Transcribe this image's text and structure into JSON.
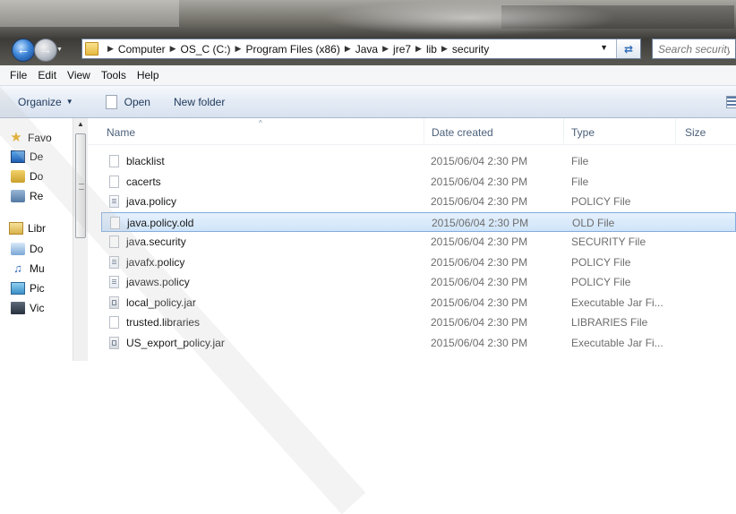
{
  "search": {
    "placeholder": "Search security"
  },
  "breadcrumb": [
    "Computer",
    "OS_C (C:)",
    "Program Files (x86)",
    "Java",
    "jre7",
    "lib",
    "security"
  ],
  "menu": [
    "File",
    "Edit",
    "View",
    "Tools",
    "Help"
  ],
  "toolbar": {
    "organize": "Organize",
    "open": "Open",
    "new_folder": "New folder"
  },
  "nav_items": [
    {
      "label": "Favo",
      "icon": "star-icon"
    },
    {
      "label": "De",
      "icon": "desktop-icon"
    },
    {
      "label": "Do",
      "icon": "downloads-icon"
    },
    {
      "label": "Re",
      "icon": "recent-places-icon"
    },
    {
      "label": "Libr",
      "icon": "libraries-icon"
    },
    {
      "label": "Do",
      "icon": "documents-icon"
    },
    {
      "label": "Mu",
      "icon": "music-icon"
    },
    {
      "label": "Pic",
      "icon": "pictures-icon"
    },
    {
      "label": "Vic",
      "icon": "videos-icon"
    }
  ],
  "columns": {
    "name": "Name",
    "date": "Date created",
    "type": "Type",
    "size": "Size"
  },
  "files": [
    {
      "name": "blacklist",
      "date": "2015/06/04 2:30 PM",
      "type": "File",
      "icon": "file-icon"
    },
    {
      "name": "cacerts",
      "date": "2015/06/04 2:30 PM",
      "type": "File",
      "icon": "file-icon"
    },
    {
      "name": "java.policy",
      "date": "2015/06/04 2:30 PM",
      "type": "POLICY File",
      "icon": "policy-file-icon"
    },
    {
      "name": "java.policy.old",
      "date": "2015/06/04 2:30 PM",
      "type": "OLD File",
      "icon": "file-icon",
      "selected": true
    },
    {
      "name": "java.security",
      "date": "2015/06/04 2:30 PM",
      "type": "SECURITY File",
      "icon": "file-icon"
    },
    {
      "name": "javafx.policy",
      "date": "2015/06/04 2:30 PM",
      "type": "POLICY File",
      "icon": "policy-file-icon"
    },
    {
      "name": "javaws.policy",
      "date": "2015/06/04 2:30 PM",
      "type": "POLICY File",
      "icon": "policy-file-icon"
    },
    {
      "name": "local_policy.jar",
      "date": "2015/06/04 2:30 PM",
      "type": "Executable Jar Fi...",
      "icon": "jar-file-icon"
    },
    {
      "name": "trusted.libraries",
      "date": "2015/06/04 2:30 PM",
      "type": "LIBRARIES File",
      "icon": "file-icon"
    },
    {
      "name": "US_export_policy.jar",
      "date": "2015/06/04 2:30 PM",
      "type": "Executable Jar Fi...",
      "icon": "jar-file-icon"
    }
  ]
}
